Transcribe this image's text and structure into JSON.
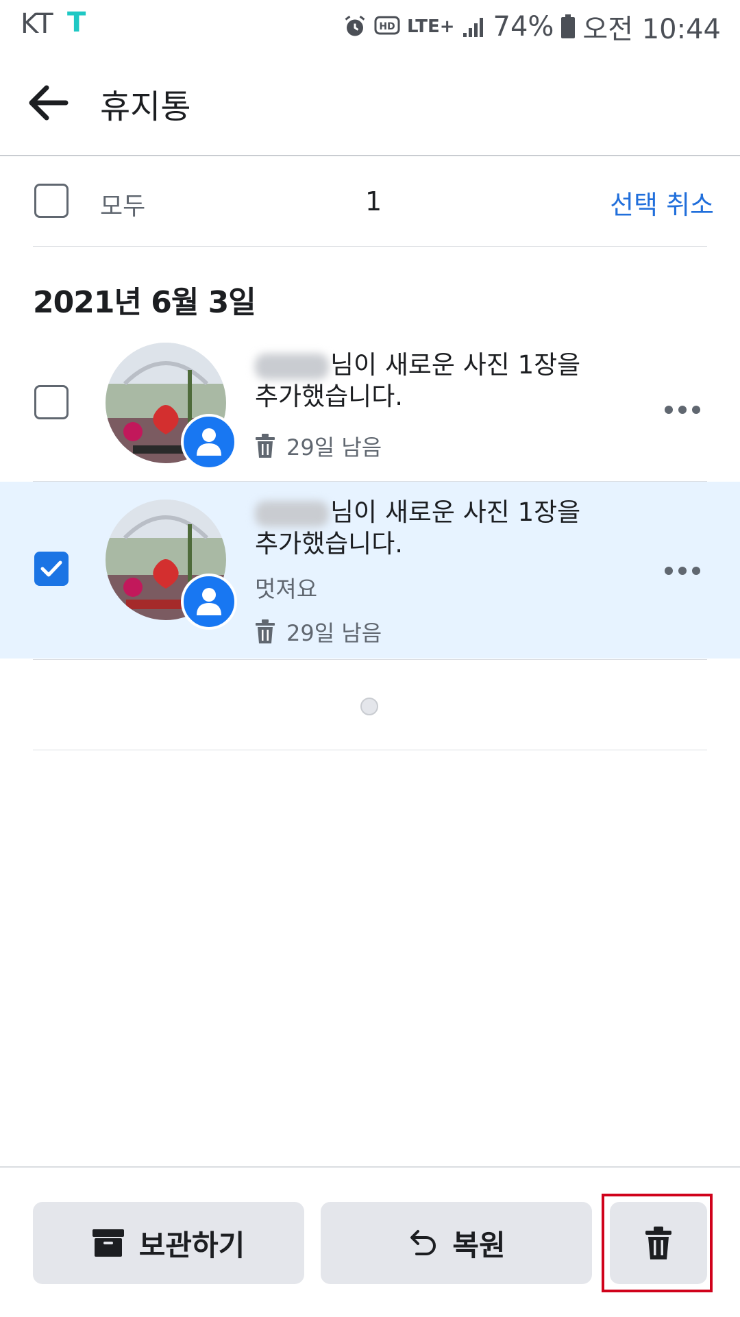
{
  "status_bar": {
    "carrier": "KT",
    "carrier_logo": "T",
    "network": "LTE+",
    "battery": "74%",
    "time": "오전 10:44",
    "icons": [
      "alarm-icon",
      "hd-voice-icon",
      "lte-icon",
      "signal-icon",
      "battery-icon"
    ]
  },
  "header": {
    "title": "휴지통",
    "back_icon": "arrow-left-icon"
  },
  "selection_bar": {
    "all_label": "모두",
    "selected_count": "1",
    "deselect_label": "선택 취소",
    "all_checked": false
  },
  "date_header": "2021년 6월 3일",
  "items": [
    {
      "text_suffix": "님이 새로운 사진 1장을 추가했습니다.",
      "comment": "",
      "days_left": "29일 남음",
      "checked": false,
      "selected": false
    },
    {
      "text_suffix": "님이 새로운 사진 1장을 추가했습니다.",
      "comment": "멋져요",
      "days_left": "29일 남음",
      "checked": true,
      "selected": true
    }
  ],
  "bottom_actions": {
    "archive_label": "보관하기",
    "restore_label": "복원",
    "archive_icon": "archive-box-icon",
    "restore_icon": "undo-arrow-icon",
    "delete_icon": "trash-icon"
  },
  "colors": {
    "accent": "#1877f2",
    "link": "#216fdb",
    "selected_row": "#e7f3ff",
    "highlight": "#d0021b"
  }
}
